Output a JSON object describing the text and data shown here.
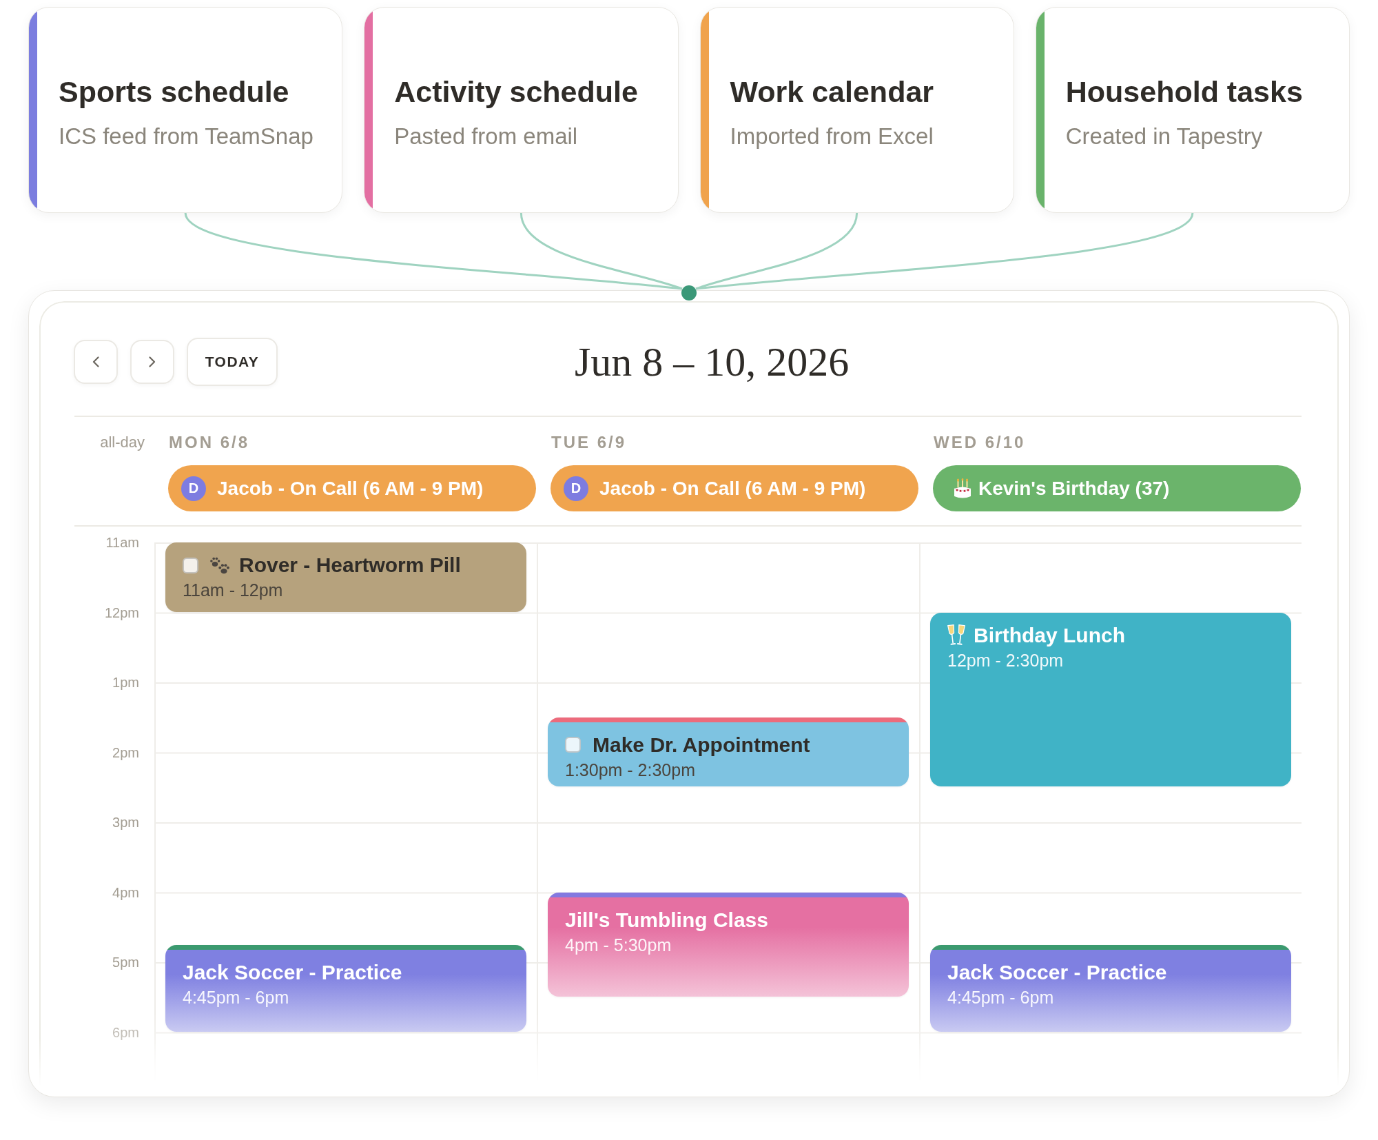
{
  "sources": [
    {
      "title": "Sports schedule",
      "subtitle": "ICS feed from TeamSnap",
      "color": "#7b7ddf"
    },
    {
      "title": "Activity schedule",
      "subtitle": "Pasted from email",
      "color": "#e36fa2"
    },
    {
      "title": "Work calendar",
      "subtitle": "Imported from Excel",
      "color": "#f0a34c"
    },
    {
      "title": "Household tasks",
      "subtitle": "Created in Tapestry",
      "color": "#69b36b"
    }
  ],
  "calendar": {
    "title": "Jun 8 – 10, 2026",
    "today_button": "TODAY",
    "all_day_label": "all-day",
    "hours": [
      "11am",
      "12pm",
      "1pm",
      "2pm",
      "3pm",
      "4pm",
      "5pm",
      "6pm"
    ],
    "days": [
      {
        "header": "MON 6/8",
        "all_day": [
          {
            "kind": "person",
            "avatar": "D",
            "title": "Jacob - On Call (6 AM - 9 PM)",
            "color": "#f0a44e"
          }
        ],
        "events": [
          {
            "kind": "pet",
            "title": "Rover - Heartworm Pill",
            "time": "11am - 12pm",
            "checked": false,
            "color": "#b6a27d",
            "faded": false
          },
          {
            "kind": "event",
            "title": "Jack Soccer - Practice",
            "time": "4:45pm - 6pm",
            "color": "#7f80e1",
            "stripe": {
              "color": "#3b9a6f"
            },
            "faded": true
          }
        ]
      },
      {
        "header": "TUE 6/9",
        "all_day": [
          {
            "kind": "person",
            "avatar": "D",
            "title": "Jacob - On Call (6 AM - 9 PM)",
            "color": "#f0a44e"
          }
        ],
        "events": [
          {
            "kind": "task",
            "title": "Make Dr. Appointment",
            "time": "1:30pm - 2:30pm",
            "checked": false,
            "color": "#7ec3e1",
            "stripe": {
              "color": "#ec6b7c"
            },
            "faded": false
          },
          {
            "kind": "event",
            "title": "Jill's Tumbling Class",
            "time": "4pm - 5:30pm",
            "color": "#e570a2",
            "stripe": {
              "color": "#8479e0"
            },
            "faded": true
          }
        ]
      },
      {
        "header": "WED 6/10",
        "all_day": [
          {
            "kind": "birthday",
            "title": "Kevin's Birthday (37)",
            "color": "#6bb46b"
          }
        ],
        "events": [
          {
            "kind": "party",
            "title": "Birthday Lunch",
            "time": "12pm - 2:30pm",
            "color": "#40b3c6",
            "faded": false
          },
          {
            "kind": "event",
            "title": "Jack Soccer - Practice",
            "time": "4:45pm - 6pm",
            "color": "#7f80e1",
            "stripe": {
              "color": "#3b9a6f"
            },
            "faded": true
          }
        ]
      }
    ]
  }
}
